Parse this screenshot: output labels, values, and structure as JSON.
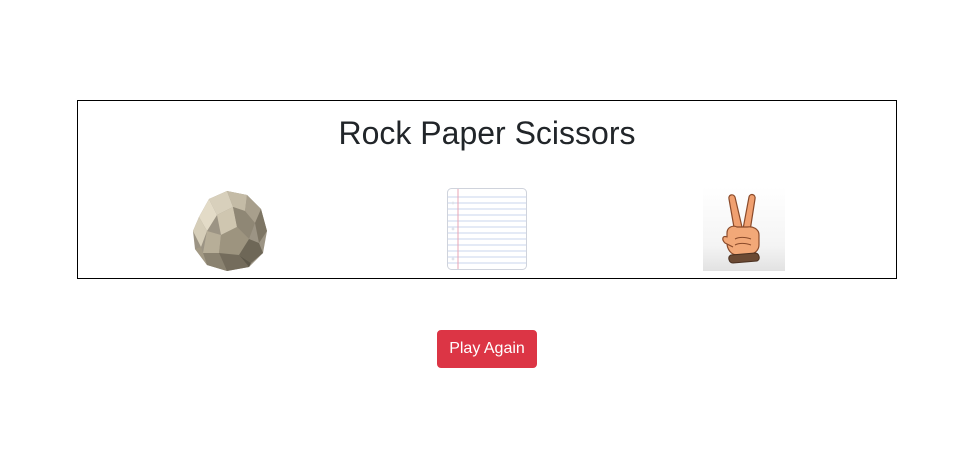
{
  "game": {
    "title": "Rock Paper Scissors",
    "choices": [
      {
        "id": "rock",
        "icon": "rock-icon"
      },
      {
        "id": "paper",
        "icon": "paper-icon"
      },
      {
        "id": "scissors",
        "icon": "scissors-hand-icon"
      }
    ]
  },
  "actions": {
    "play_again_label": "Play Again"
  },
  "colors": {
    "button_bg": "#dc3545",
    "button_text": "#ffffff",
    "border": "#000000",
    "title_text": "#212529"
  }
}
